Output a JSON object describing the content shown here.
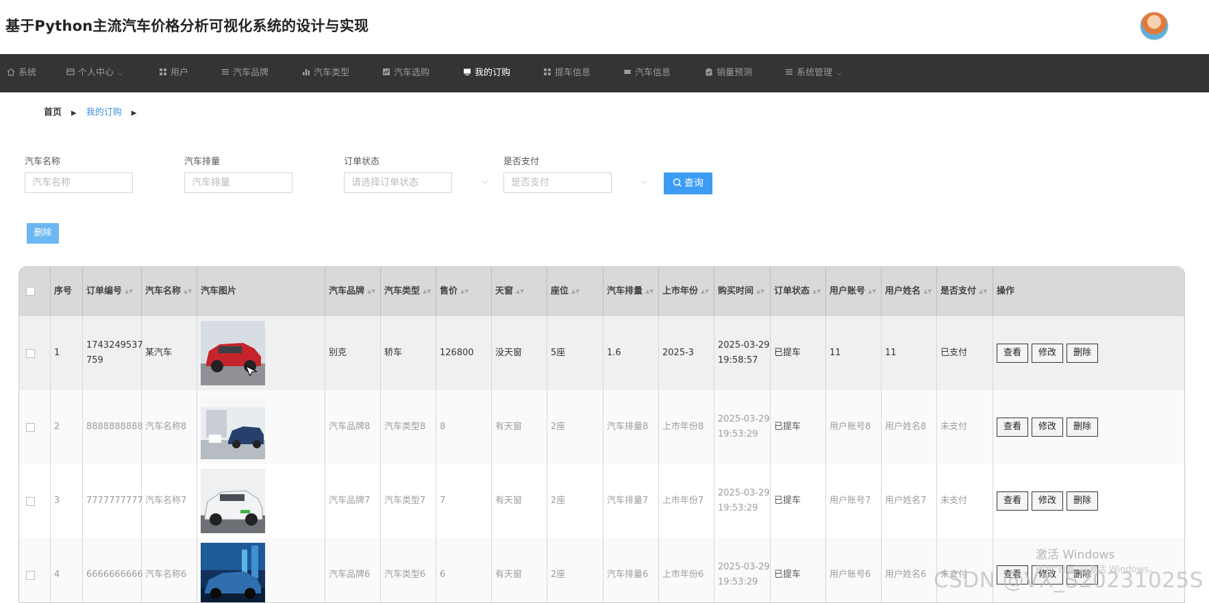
{
  "app": {
    "title": "基于Python主流汽车价格分析可视化系统的设计与实现"
  },
  "nav": {
    "items": [
      {
        "label": "系统",
        "icon": "home-icon"
      },
      {
        "label": "个人中心",
        "icon": "card-icon",
        "dropdown": true
      },
      {
        "label": "用户",
        "icon": "grid-icon"
      },
      {
        "label": "汽车品牌",
        "icon": "list-icon"
      },
      {
        "label": "汽车类型",
        "icon": "bar-icon"
      },
      {
        "label": "汽车选购",
        "icon": "chart-icon"
      },
      {
        "label": "我的订购",
        "icon": "monitor-icon",
        "active": true
      },
      {
        "label": "提车信息",
        "icon": "grid-icon"
      },
      {
        "label": "汽车信息",
        "icon": "ticket-icon"
      },
      {
        "label": "销量预测",
        "icon": "clipboard-icon"
      },
      {
        "label": "系统管理",
        "icon": "list-icon",
        "dropdown": true
      }
    ]
  },
  "breadcrumb": {
    "home": "首页",
    "current": "我的订购"
  },
  "search": {
    "fields": [
      {
        "label": "汽车名称",
        "placeholder": "汽车名称"
      },
      {
        "label": "汽车排量",
        "placeholder": "汽车排量"
      },
      {
        "label": "订单状态",
        "placeholder": "请选择订单状态"
      },
      {
        "label": "是否支付",
        "placeholder": "是否支付"
      }
    ],
    "query_label": "查询"
  },
  "toolbar": {
    "delete_label": "删除"
  },
  "table": {
    "columns": [
      "序号",
      "订单编号",
      "汽车名称",
      "汽车图片",
      "汽车品牌",
      "汽车类型",
      "售价",
      "天窗",
      "座位",
      "汽车排量",
      "上市年份",
      "购买时间",
      "订单状态",
      "用户账号",
      "用户姓名",
      "是否支付",
      "操作"
    ],
    "rows": [
      {
        "no": "1",
        "order_no_1": "1743249537",
        "order_no_2": "759",
        "name": "某汽车",
        "brand": "别克",
        "type": "轿车",
        "price": "126800",
        "sunroof": "没天窗",
        "seats": "5座",
        "displacement": "1.6",
        "year": "2025-3",
        "buy_date": "2025-03-29",
        "buy_time": "19:58:57",
        "status": "已提车",
        "account": "11",
        "username": "11",
        "paid": "已支付"
      },
      {
        "no": "2",
        "order_no_1": "8888888888",
        "order_no_2": "",
        "name": "汽车名称8",
        "brand": "汽车品牌8",
        "type": "汽车类型8",
        "price": "8",
        "sunroof": "有天窗",
        "seats": "2座",
        "displacement": "汽车排量8",
        "year": "上市年份8",
        "buy_date": "2025-03-29",
        "buy_time": "19:53:29",
        "status": "已提车",
        "account": "用户账号8",
        "username": "用户姓名8",
        "paid": "未支付"
      },
      {
        "no": "3",
        "order_no_1": "7777777777",
        "order_no_2": "",
        "name": "汽车名称7",
        "brand": "汽车品牌7",
        "type": "汽车类型7",
        "price": "7",
        "sunroof": "有天窗",
        "seats": "2座",
        "displacement": "汽车排量7",
        "year": "上市年份7",
        "buy_date": "2025-03-29",
        "buy_time": "19:53:29",
        "status": "已提车",
        "account": "用户账号7",
        "username": "用户姓名7",
        "paid": "未支付"
      },
      {
        "no": "4",
        "order_no_1": "6666666666",
        "order_no_2": "",
        "name": "汽车名称6",
        "brand": "汽车品牌6",
        "type": "汽车类型6",
        "price": "6",
        "sunroof": "有天窗",
        "seats": "2座",
        "displacement": "汽车排量6",
        "year": "上市年份6",
        "buy_date": "2025-03-29",
        "buy_time": "19:53:29",
        "status": "已提车",
        "account": "用户账号6",
        "username": "用户姓名6",
        "paid": "未支付"
      }
    ],
    "actions": {
      "view": "查看",
      "edit": "修改",
      "delete": "删除"
    }
  },
  "watermark": {
    "activate_title": "激活 Windows",
    "activate_sub": "转到\"设置\"以激活 Windows。",
    "csdn": "CSDN @VX_S20231025S"
  },
  "colors": {
    "nav_bg": "#343434",
    "accent": "#3d9df5",
    "delete_btn": "#6cb7f2"
  }
}
